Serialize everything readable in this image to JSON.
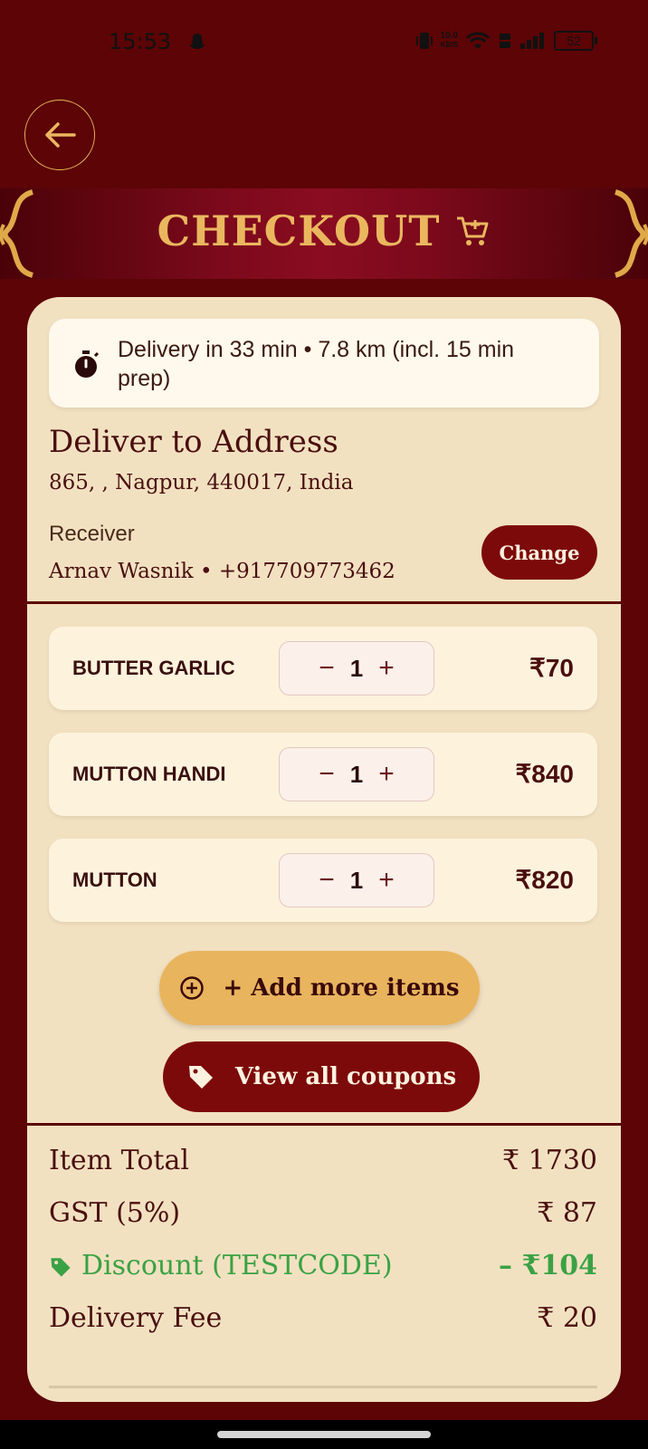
{
  "status_bar": {
    "time": "15:53",
    "net_speed_value": "10.0",
    "net_speed_unit": "KB/S",
    "battery": "52"
  },
  "header": {
    "title": "CHECKOUT"
  },
  "delivery": {
    "eta_text": "Delivery in 33 min • 7.8 km (incl. 15 min prep)"
  },
  "address": {
    "title": "Deliver to Address",
    "line": "865, , Nagpur, 440017, India",
    "receiver_label": "Receiver",
    "receiver_value": "Arnav Wasnik • +917709773462",
    "change_label": "Change"
  },
  "items": [
    {
      "name": "BUTTER GARLIC",
      "qty": "1",
      "price": "₹70",
      "minus": "−",
      "plus": "+"
    },
    {
      "name": "MUTTON HANDI",
      "qty": "1",
      "price": "₹840",
      "minus": "−",
      "plus": "+"
    },
    {
      "name": "MUTTON",
      "qty": "1",
      "price": "₹820",
      "minus": "−",
      "plus": "+"
    }
  ],
  "actions": {
    "add_more_label": "+ Add more items",
    "coupons_label": "View all coupons"
  },
  "bill": {
    "item_total_label": "Item Total",
    "item_total_value": "₹ 1730",
    "gst_label": "GST (5%)",
    "gst_value": "₹ 87",
    "discount_label": "Discount (TESTCODE)",
    "discount_value": "– ₹104",
    "delivery_label": "Delivery Fee",
    "delivery_value": "₹ 20"
  },
  "colors": {
    "background": "#5c0406",
    "card": "#f2e1c1",
    "accent_gold": "#e9b45e",
    "accent_maroon": "#7d0a0a",
    "discount_green": "#3aa244"
  },
  "icons": [
    "back-arrow-icon",
    "cart-icon",
    "stopwatch-icon",
    "add-circle-icon",
    "tag-icon"
  ]
}
